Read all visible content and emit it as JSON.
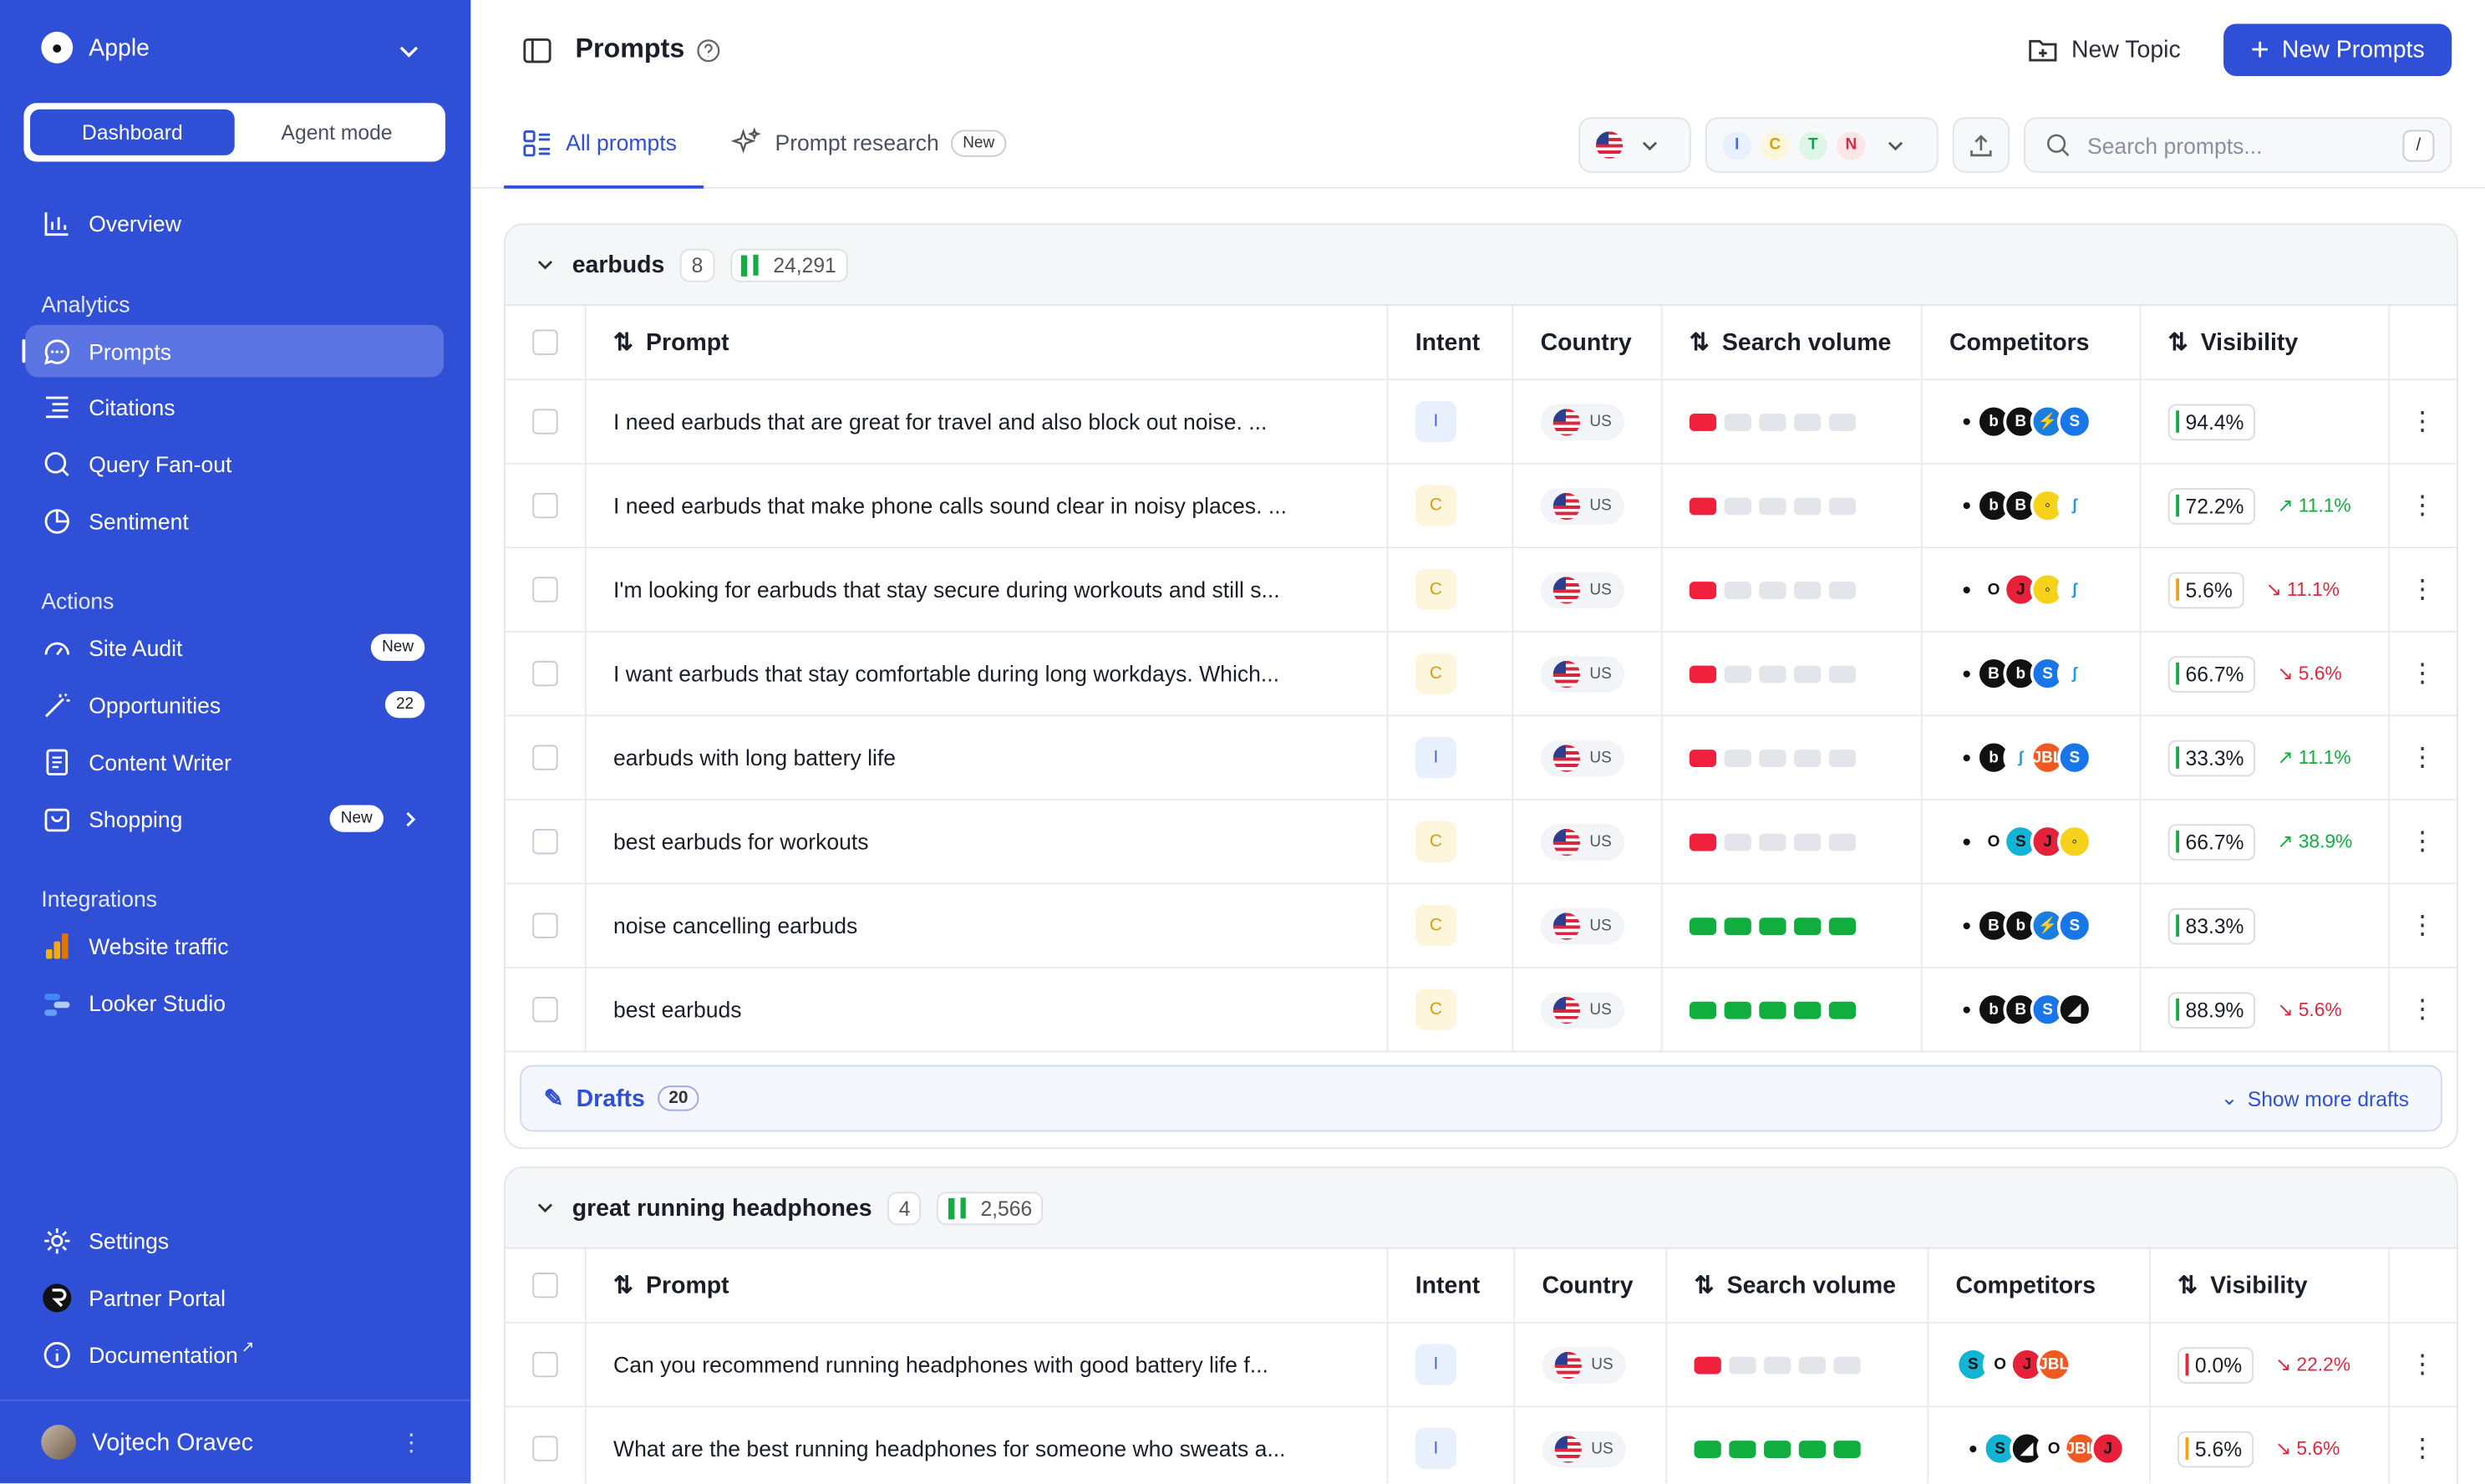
{
  "sidebar": {
    "brand": "Apple",
    "modes": [
      "Dashboard",
      "Agent mode"
    ],
    "overview": "Overview",
    "analytics_title": "Analytics",
    "analytics": [
      "Prompts",
      "Citations",
      "Query Fan-out",
      "Sentiment"
    ],
    "actions_title": "Actions",
    "actions": [
      {
        "label": "Site Audit",
        "badge": "New"
      },
      {
        "label": "Opportunities",
        "badge": "22"
      },
      {
        "label": "Content Writer",
        "badge": ""
      },
      {
        "label": "Shopping",
        "badge": "New"
      }
    ],
    "integrations_title": "Integrations",
    "integrations": [
      "Website traffic",
      "Looker Studio"
    ],
    "bottom": [
      "Settings",
      "Partner Portal",
      "Documentation"
    ],
    "user": "Vojtech Oravec"
  },
  "header": {
    "title": "Prompts",
    "new_topic": "New Topic",
    "new_prompts": "New Prompts"
  },
  "tabs": {
    "all": "All prompts",
    "research": "Prompt research",
    "research_badge": "New"
  },
  "filters": {
    "intents": [
      "I",
      "C",
      "T",
      "N"
    ]
  },
  "search": {
    "placeholder": "Search prompts...",
    "shortcut": "/"
  },
  "columns": [
    "Prompt",
    "Intent",
    "Country",
    "Search volume",
    "Competitors",
    "Visibility"
  ],
  "colors": {
    "accent": "#2f50d6",
    "up": "#0fae3e",
    "down": "#e0283d"
  },
  "groups": [
    {
      "name": "earbuds",
      "count": "8",
      "volume": "24,291",
      "rows": [
        {
          "prompt": "I need earbuds that are great for travel and also block out noise. ...",
          "intent": "I",
          "country": "US",
          "volume": 1,
          "vis": "94.4%",
          "delta": "",
          "dir": "",
          "comp": [
            "apple",
            "beats",
            "bose",
            "jbl2",
            "samsung"
          ]
        },
        {
          "prompt": "I need earbuds that make phone calls sound clear in noisy places. ...",
          "intent": "C",
          "country": "US",
          "volume": 1,
          "vis": "72.2%",
          "delta": "11.1%",
          "dir": "up",
          "comp": [
            "apple",
            "beats",
            "bose",
            "yellow",
            "sky"
          ]
        },
        {
          "prompt": "I'm looking for earbuds that stay secure during workouts and still s...",
          "intent": "C",
          "country": "US",
          "volume": 1,
          "vis": "5.6%",
          "delta": "11.1%",
          "dir": "down",
          "comp": [
            "apple",
            "ring",
            "jred",
            "yellow",
            "sky"
          ]
        },
        {
          "prompt": "I want earbuds that stay comfortable during long workdays. Which...",
          "intent": "C",
          "country": "US",
          "volume": 1,
          "vis": "66.7%",
          "delta": "5.6%",
          "dir": "down",
          "comp": [
            "apple",
            "bose",
            "beats",
            "samsung",
            "sky"
          ]
        },
        {
          "prompt": "earbuds with long battery life",
          "intent": "I",
          "country": "US",
          "volume": 1,
          "vis": "33.3%",
          "delta": "11.1%",
          "dir": "up",
          "comp": [
            "apple",
            "beats",
            "sky",
            "jbl",
            "samsung"
          ]
        },
        {
          "prompt": "best earbuds for workouts",
          "intent": "C",
          "country": "US",
          "volume": 1,
          "vis": "66.7%",
          "delta": "38.9%",
          "dir": "up",
          "comp": [
            "apple",
            "ring",
            "teal",
            "jred",
            "yellow"
          ]
        },
        {
          "prompt": "noise cancelling earbuds",
          "intent": "C",
          "country": "US",
          "volume": 5,
          "vis": "83.3%",
          "delta": "",
          "dir": "",
          "comp": [
            "apple",
            "bose",
            "beats",
            "jbl2",
            "samsung"
          ]
        },
        {
          "prompt": "best earbuds",
          "intent": "C",
          "country": "US",
          "volume": 5,
          "vis": "88.9%",
          "delta": "5.6%",
          "dir": "down",
          "comp": [
            "apple",
            "beats",
            "bose",
            "samsung",
            "black"
          ]
        }
      ],
      "drafts_label": "Drafts",
      "drafts_count": "20",
      "show_more": "Show more drafts"
    },
    {
      "name": "great running headphones",
      "count": "4",
      "volume": "2,566",
      "rows": [
        {
          "prompt": "Can you recommend running headphones with good battery life f...",
          "intent": "I",
          "country": "US",
          "volume": 1,
          "vis": "0.0%",
          "delta": "22.2%",
          "dir": "down",
          "comp": [
            "teal",
            "ring",
            "jred",
            "jbl"
          ]
        },
        {
          "prompt": "What are the best running headphones for someone who sweats a...",
          "intent": "I",
          "country": "US",
          "volume": 5,
          "vis": "5.6%",
          "delta": "5.6%",
          "dir": "down",
          "comp": [
            "apple",
            "teal",
            "black",
            "ring",
            "jbl",
            "jred"
          ]
        }
      ]
    }
  ]
}
